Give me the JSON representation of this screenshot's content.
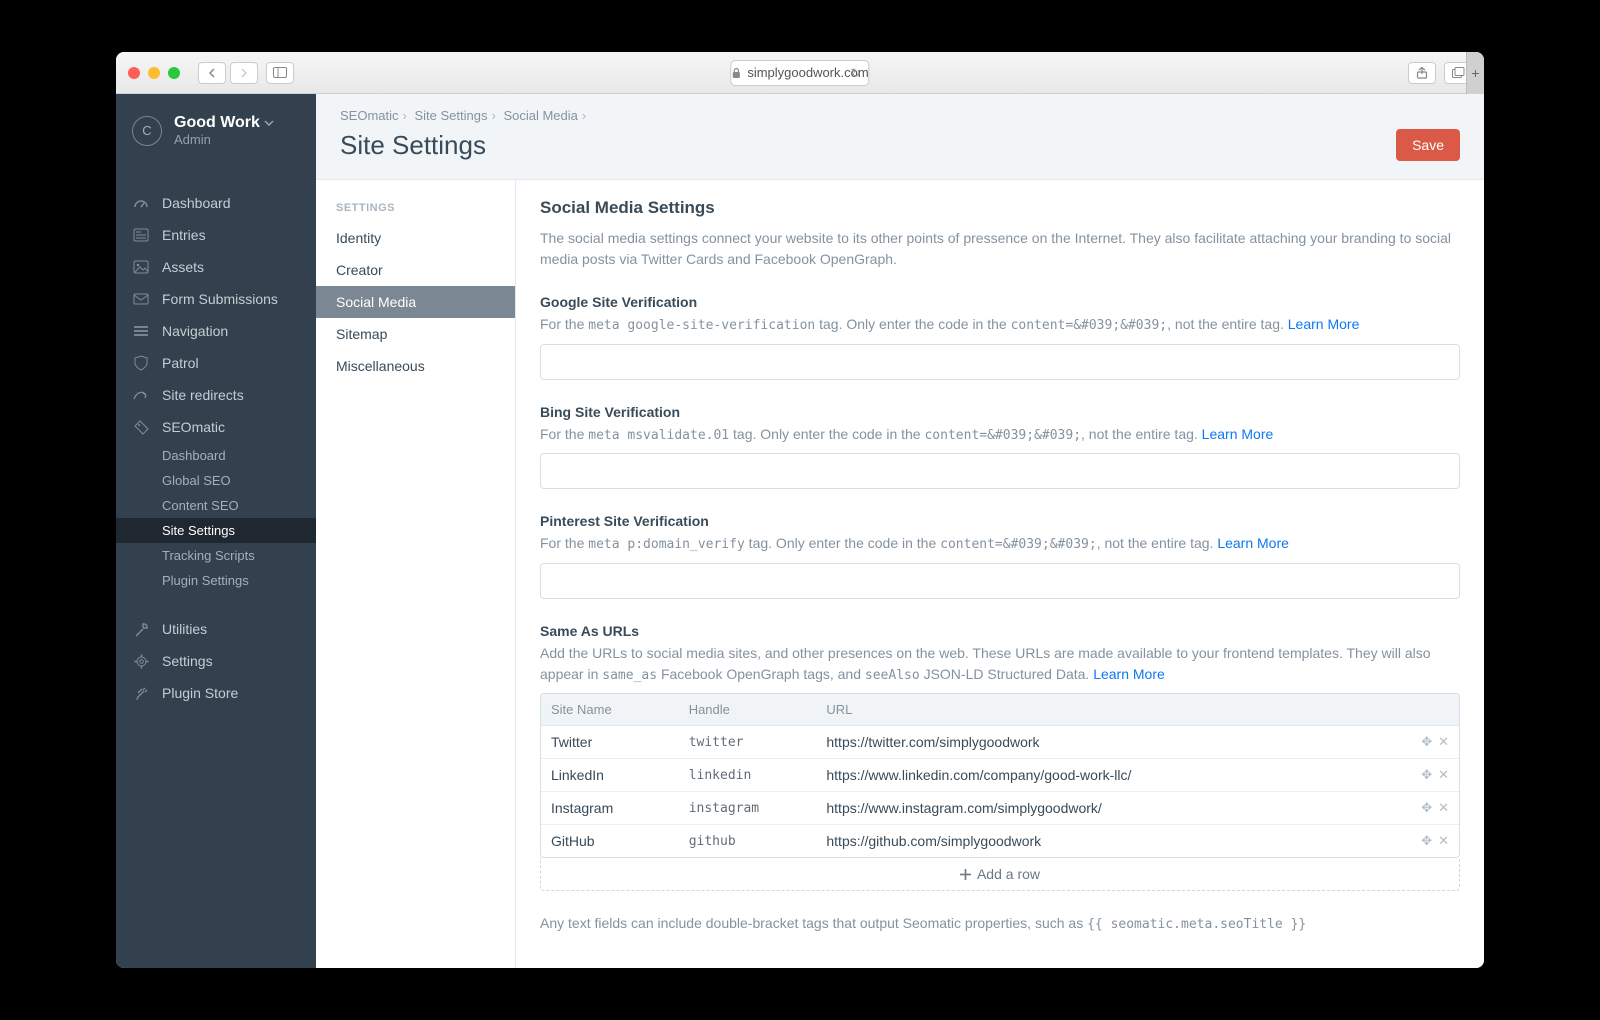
{
  "browser": {
    "url": "simplygoodwork.com"
  },
  "sidebar": {
    "site_name": "Good Work",
    "role": "Admin",
    "logo_initial": "C",
    "items": [
      {
        "label": "Dashboard"
      },
      {
        "label": "Entries"
      },
      {
        "label": "Assets"
      },
      {
        "label": "Form Submissions"
      },
      {
        "label": "Navigation"
      },
      {
        "label": "Patrol"
      },
      {
        "label": "Site redirects"
      },
      {
        "label": "SEOmatic"
      }
    ],
    "seomatic_sub": [
      {
        "label": "Dashboard"
      },
      {
        "label": "Global SEO"
      },
      {
        "label": "Content SEO"
      },
      {
        "label": "Site Settings"
      },
      {
        "label": "Tracking Scripts"
      },
      {
        "label": "Plugin Settings"
      }
    ],
    "bottom": [
      {
        "label": "Utilities"
      },
      {
        "label": "Settings"
      },
      {
        "label": "Plugin Store"
      }
    ]
  },
  "breadcrumbs": [
    "SEOmatic",
    "Site Settings",
    "Social Media"
  ],
  "page_title": "Site Settings",
  "save_label": "Save",
  "settings_nav": {
    "header": "SETTINGS",
    "items": [
      {
        "label": "Identity"
      },
      {
        "label": "Creator"
      },
      {
        "label": "Social Media"
      },
      {
        "label": "Sitemap"
      },
      {
        "label": "Miscellaneous"
      }
    ]
  },
  "section_title": "Social Media Settings",
  "intro": "The social media settings connect your website to its other points of pressence on the Internet. They also facilitate attaching your branding to social media posts via Twitter Cards and Facebook OpenGraph.",
  "google": {
    "label": "Google Site Verification",
    "hint_prefix": "For the ",
    "hint_code1": "meta google-site-verification",
    "hint_mid": " tag. Only enter the code in the ",
    "hint_code2": "content=&#039;&#039;",
    "hint_suffix": ", not the entire tag. ",
    "learn": "Learn More"
  },
  "bing": {
    "label": "Bing Site Verification",
    "hint_prefix": "For the ",
    "hint_code1": "meta msvalidate.01",
    "hint_mid": " tag. Only enter the code in the ",
    "hint_code2": "content=&#039;&#039;",
    "hint_suffix": ", not the entire tag. ",
    "learn": "Learn More"
  },
  "pinterest": {
    "label": "Pinterest Site Verification",
    "hint_prefix": "For the ",
    "hint_code1": "meta p:domain_verify",
    "hint_mid": " tag. Only enter the code in the ",
    "hint_code2": "content=&#039;&#039;",
    "hint_suffix": ", not the entire tag. ",
    "learn": "Learn More"
  },
  "same_as": {
    "label": "Same As URLs",
    "hint_p1": "Add the URLs to social media sites, and other presences on the web. These URLs are made available to your frontend templates. They will also appear in ",
    "hint_c1": "same_as",
    "hint_p2": " Facebook OpenGraph tags, and ",
    "hint_c2": "seeAlso",
    "hint_p3": " JSON-LD Structured Data. ",
    "learn": "Learn More",
    "cols": {
      "site": "Site Name",
      "handle": "Handle",
      "url": "URL"
    },
    "rows": [
      {
        "site": "Twitter",
        "handle": "twitter",
        "url": "https://twitter.com/simplygoodwork"
      },
      {
        "site": "LinkedIn",
        "handle": "linkedin",
        "url": "https://www.linkedin.com/company/good-work-llc/"
      },
      {
        "site": "Instagram",
        "handle": "instagram",
        "url": "https://www.instagram.com/simplygoodwork/"
      },
      {
        "site": "GitHub",
        "handle": "github",
        "url": "https://github.com/simplygoodwork"
      }
    ],
    "add_row": "Add a row"
  },
  "footnote": {
    "p1": "Any text fields can include double-bracket tags that output Seomatic properties, such as ",
    "c1": "{{ seomatic.meta.seoTitle }}"
  }
}
